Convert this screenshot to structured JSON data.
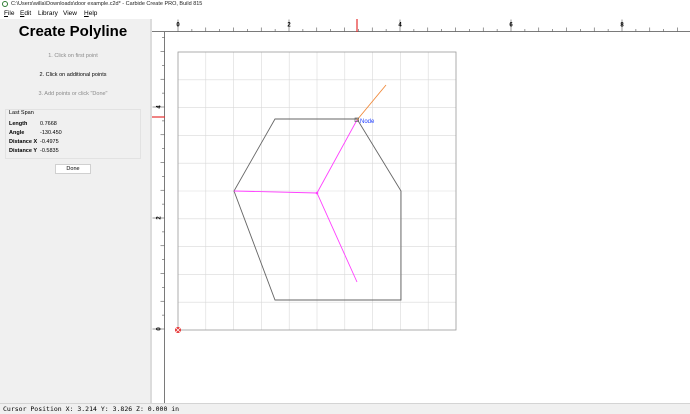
{
  "window": {
    "title": "C:\\Users\\willa\\Downloads\\door example.c2d* - Carbide Create PRO, Build 815"
  },
  "menu": {
    "file": {
      "key": "F",
      "rest": "ile"
    },
    "edit": {
      "key": "E",
      "rest": "dit"
    },
    "library": {
      "key": "",
      "rest": "Library"
    },
    "view": {
      "key": "",
      "rest": "View"
    },
    "help": {
      "key": "H",
      "rest": "elp"
    }
  },
  "panel": {
    "heading": "Create Polyline",
    "step1": "1. Click on first point",
    "step2": "2. Click on additional points",
    "step3": "3. Add points or click \"Done\"",
    "last_span": {
      "title": "Last Span",
      "length_label": "Length",
      "length_value": "0.7668",
      "angle_label": "Angle",
      "angle_value": "-130.450",
      "dx_label": "Distance X",
      "dx_value": "-0.4975",
      "dy_label": "Distance Y",
      "dy_value": "-0.5835"
    },
    "done_label": "Done"
  },
  "canvas": {
    "ruler_top_labels": [
      "0",
      "2",
      "4",
      "6",
      "8"
    ],
    "ruler_left_labels": [
      "4",
      "2",
      "0"
    ],
    "node_label": "Node",
    "colors": {
      "hexagon": "#666666",
      "polyline": "#ff40ff",
      "rubber_band": "#f08a3c",
      "cursor_marker": "#e53030",
      "node_label": "#1e3cff",
      "grid": "#d9d9d9"
    }
  },
  "status": {
    "text": "Cursor Position X: 3.214 Y: 3.826 Z: 0.000 in"
  }
}
